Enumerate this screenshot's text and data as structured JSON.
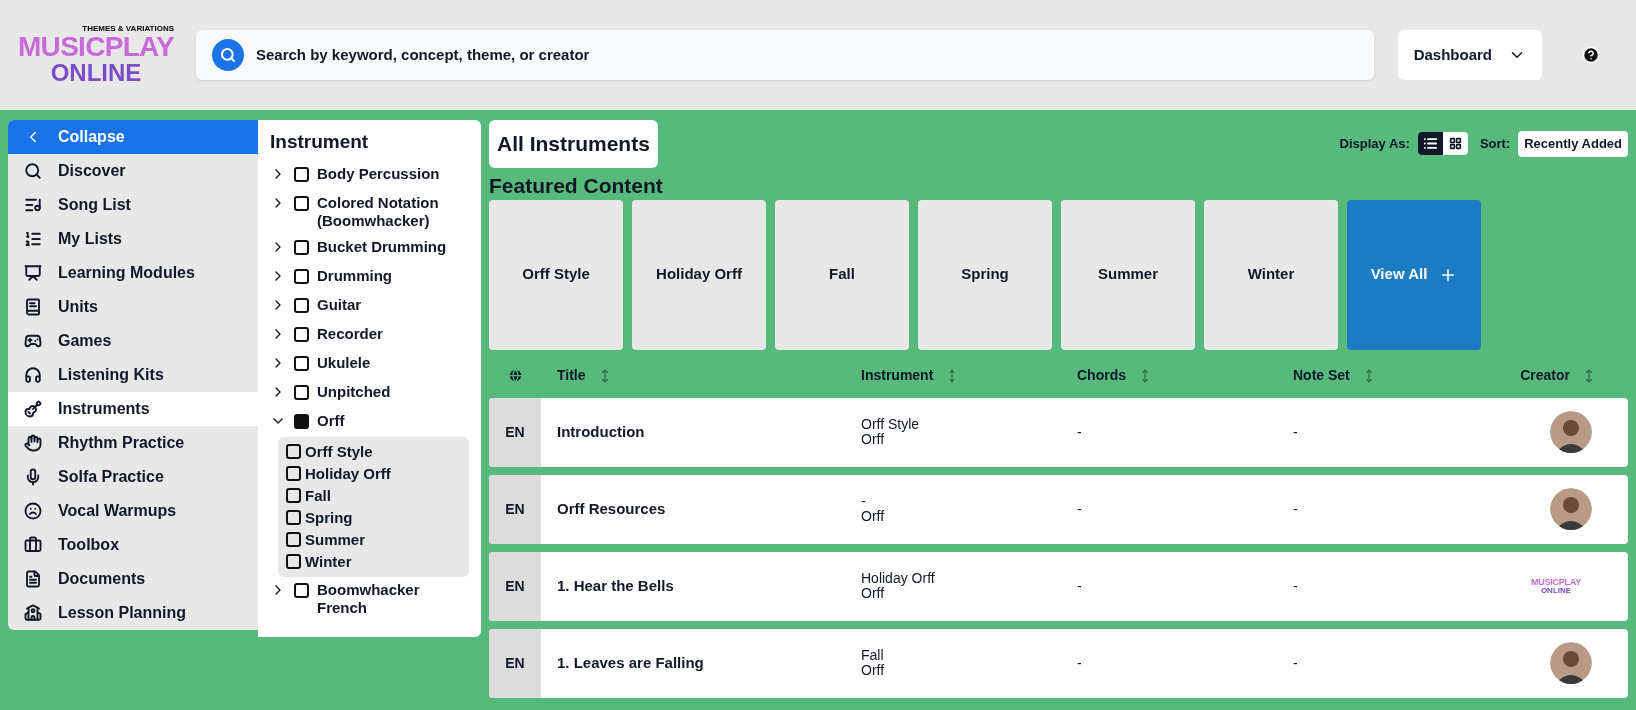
{
  "logo": {
    "tagline": "THEMES & VARIATIONS",
    "word1": "MUSICPLAY",
    "word2": "ONLINE"
  },
  "search": {
    "placeholder": "Search by keyword, concept, theme, or creator"
  },
  "dashboard": {
    "label": "Dashboard"
  },
  "nav": {
    "collapse": "Collapse",
    "items": [
      {
        "label": "Discover",
        "selected": false
      },
      {
        "label": "Song List",
        "selected": false
      },
      {
        "label": "My Lists",
        "selected": false
      },
      {
        "label": "Learning Modules",
        "selected": false
      },
      {
        "label": "Units",
        "selected": false
      },
      {
        "label": "Games",
        "selected": false
      },
      {
        "label": "Listening Kits",
        "selected": false
      },
      {
        "label": "Instruments",
        "selected": true
      },
      {
        "label": "Rhythm Practice",
        "selected": false
      },
      {
        "label": "Solfa Practice",
        "selected": false
      },
      {
        "label": "Vocal Warmups",
        "selected": false
      },
      {
        "label": "Toolbox",
        "selected": false
      },
      {
        "label": "Documents",
        "selected": false
      },
      {
        "label": "Lesson Planning",
        "selected": false
      }
    ]
  },
  "filter": {
    "title": "Instrument",
    "items": [
      {
        "label": "Body Percussion",
        "checked": false,
        "expanded": false
      },
      {
        "label": "Colored Notation (Boomwhacker)",
        "checked": false,
        "expanded": false
      },
      {
        "label": "Bucket Drumming",
        "checked": false,
        "expanded": false
      },
      {
        "label": "Drumming",
        "checked": false,
        "expanded": false
      },
      {
        "label": "Guitar",
        "checked": false,
        "expanded": false
      },
      {
        "label": "Recorder",
        "checked": false,
        "expanded": false
      },
      {
        "label": "Ukulele",
        "checked": false,
        "expanded": false
      },
      {
        "label": "Unpitched",
        "checked": false,
        "expanded": false
      },
      {
        "label": "Orff",
        "checked": true,
        "expanded": true,
        "children": [
          {
            "label": "Orff Style",
            "checked": false
          },
          {
            "label": "Holiday Orff",
            "checked": false
          },
          {
            "label": "Fall",
            "checked": false
          },
          {
            "label": "Spring",
            "checked": false
          },
          {
            "label": "Summer",
            "checked": false
          },
          {
            "label": "Winter",
            "checked": false
          }
        ]
      },
      {
        "label": "Boomwhacker French",
        "checked": false,
        "expanded": false
      }
    ]
  },
  "page_title": "All Instruments",
  "display": {
    "label": "Display As:",
    "options": [
      {
        "kind": "list",
        "selected": true
      },
      {
        "kind": "grid",
        "selected": false
      }
    ]
  },
  "sort": {
    "label": "Sort:",
    "value": "Recently Added"
  },
  "featured": {
    "title": "Featured Content",
    "tiles": [
      {
        "label": "Orff Style",
        "kind": "category"
      },
      {
        "label": "Holiday Orff",
        "kind": "category"
      },
      {
        "label": "Fall",
        "kind": "category"
      },
      {
        "label": "Spring",
        "kind": "category"
      },
      {
        "label": "Summer",
        "kind": "category"
      },
      {
        "label": "Winter",
        "kind": "category"
      },
      {
        "label": "View All",
        "kind": "more"
      }
    ]
  },
  "table": {
    "columns": [
      {
        "label": "Title"
      },
      {
        "label": "Instrument"
      },
      {
        "label": "Chords"
      },
      {
        "label": "Note Set"
      },
      {
        "label": "Creator"
      }
    ],
    "rows": [
      {
        "lang": "EN",
        "title": "Introduction",
        "instrument": [
          "Orff Style",
          "Orff"
        ],
        "chords": "-",
        "note_set": "-"
      },
      {
        "lang": "EN",
        "title": "Orff Resources",
        "instrument": [
          "-",
          "Orff"
        ],
        "chords": "-",
        "note_set": "-"
      },
      {
        "lang": "EN",
        "title": "1. Hear the Bells",
        "instrument": [
          "Holiday Orff",
          "Orff"
        ],
        "chords": "-",
        "note_set": "-",
        "creator": {
          "kind": "logo",
          "word1": "MUSICPLAY",
          "word2": "ONLINE"
        }
      },
      {
        "lang": "EN",
        "title": "1. Leaves are Falling",
        "instrument": [
          "Fall",
          "Orff"
        ],
        "chords": "-",
        "note_set": "-"
      }
    ]
  }
}
